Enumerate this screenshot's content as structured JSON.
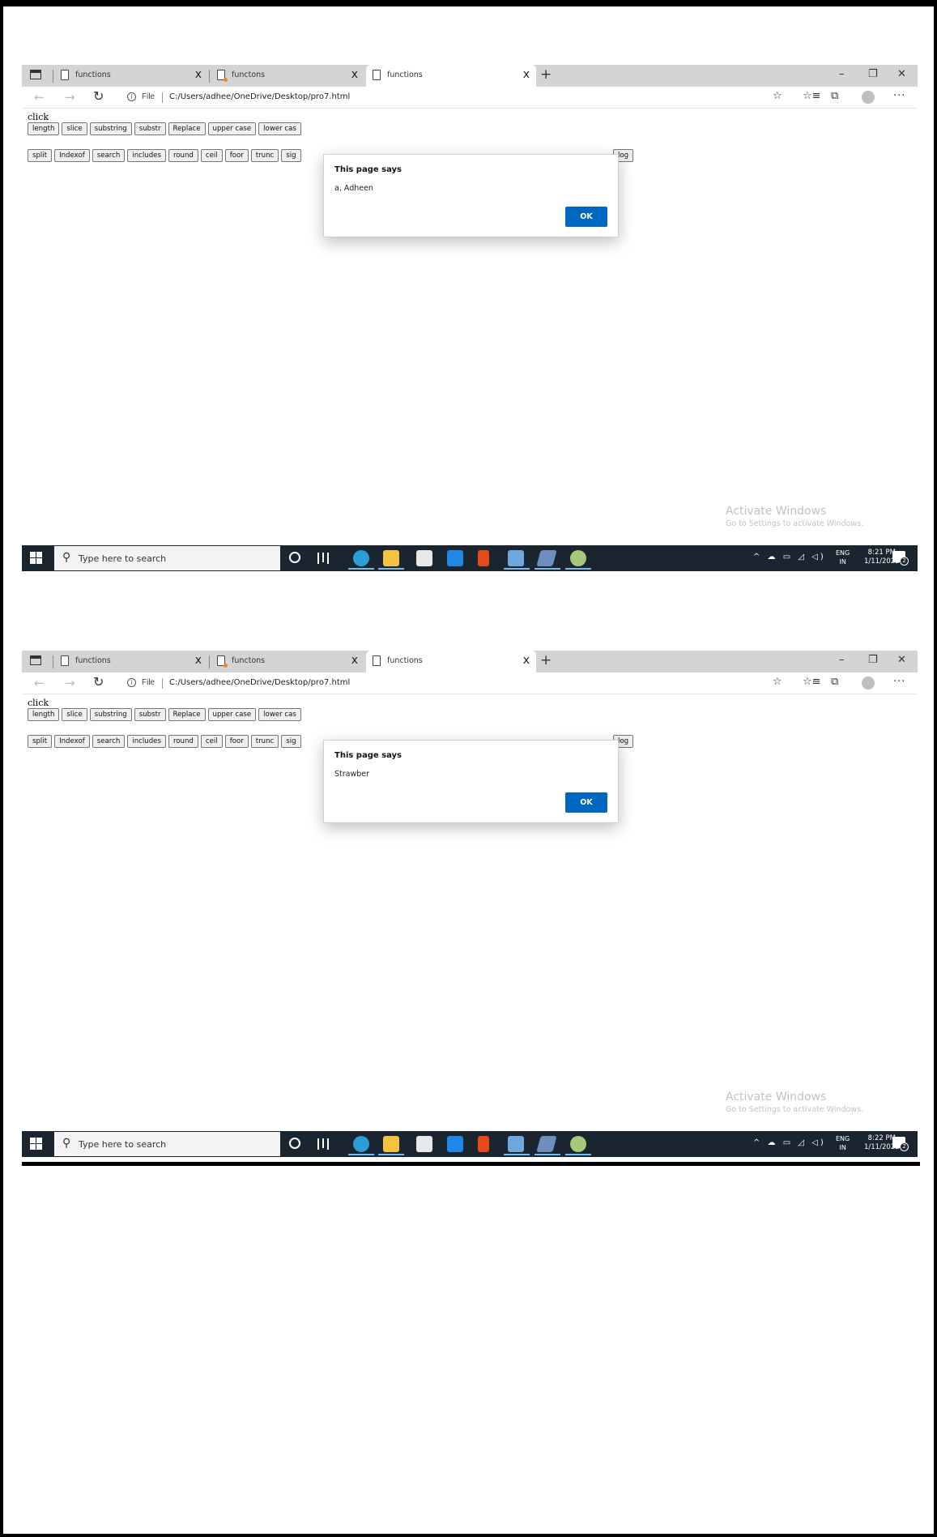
{
  "screenshots": [
    {
      "tabs": [
        {
          "label": "functions",
          "close": "x"
        },
        {
          "label": "functons",
          "close": "x"
        },
        {
          "label": "functions",
          "close": "x"
        }
      ],
      "new_tab": "+",
      "window_controls": {
        "minimize": "–",
        "maximize": "❐",
        "close": "✕"
      },
      "address": {
        "scheme": "File",
        "url": "C:/Users/adhee/OneDrive/Desktop/pro7.html"
      },
      "page": {
        "heading": "click",
        "row1": [
          "length",
          "slice",
          "substring",
          "substr",
          "Replace",
          "upper case",
          "lower cas"
        ],
        "row2": [
          "split",
          "Indexof",
          "search",
          "includes",
          "round",
          "ceil",
          "foor",
          "trunc",
          "sig"
        ],
        "row2_end": "log"
      },
      "dialog": {
        "title": "This page says",
        "message": "a, Adheen",
        "ok": "OK"
      },
      "watermark": {
        "title": "Activate Windows",
        "subtitle": "Go to Settings to activate Windows."
      },
      "taskbar": {
        "search_placeholder": "Type here to search",
        "lang_top": "ENG",
        "lang_bottom": "IN",
        "time": "8:21 PM",
        "date": "1/11/2022",
        "notification_count": "2"
      }
    },
    {
      "tabs": [
        {
          "label": "functions",
          "close": "x"
        },
        {
          "label": "functons",
          "close": "x"
        },
        {
          "label": "functions",
          "close": "x"
        }
      ],
      "new_tab": "+",
      "window_controls": {
        "minimize": "–",
        "maximize": "❐",
        "close": "✕"
      },
      "address": {
        "scheme": "File",
        "url": "C:/Users/adhee/OneDrive/Desktop/pro7.html"
      },
      "page": {
        "heading": "click",
        "row1": [
          "length",
          "slice",
          "substring",
          "substr",
          "Replace",
          "upper case",
          "lower cas"
        ],
        "row2": [
          "split",
          "Indexof",
          "search",
          "includes",
          "round",
          "ceil",
          "foor",
          "trunc",
          "sig"
        ],
        "row2_end": "log"
      },
      "dialog": {
        "title": "This page says",
        "message": "Strawber",
        "ok": "OK"
      },
      "watermark": {
        "title": "Activate Windows",
        "subtitle": "Go to Settings to activate Windows."
      },
      "taskbar": {
        "search_placeholder": "Type here to search",
        "lang_top": "ENG",
        "lang_bottom": "IN",
        "time": "8:22 PM",
        "date": "1/11/2022",
        "notification_count": "2"
      }
    }
  ],
  "colors": {
    "dialog_ok": "#0067c0",
    "taskbar": "#1b2530",
    "tabbar": "#d4d4d4"
  },
  "icons": [
    "tab-actions-icon",
    "document-icon",
    "back-arrow-icon",
    "forward-arrow-icon",
    "reload-icon",
    "info-icon",
    "favorite-add-icon",
    "favorites-icon",
    "collections-icon",
    "profile-icon",
    "more-icon",
    "windows-start-icon",
    "search-icon",
    "cortana-icon",
    "task-view-icon",
    "edge-icon",
    "file-explorer-icon",
    "store-icon",
    "mail-icon",
    "office-icon",
    "notepad-icon",
    "word-icon",
    "paint-icon",
    "notification-icon"
  ]
}
